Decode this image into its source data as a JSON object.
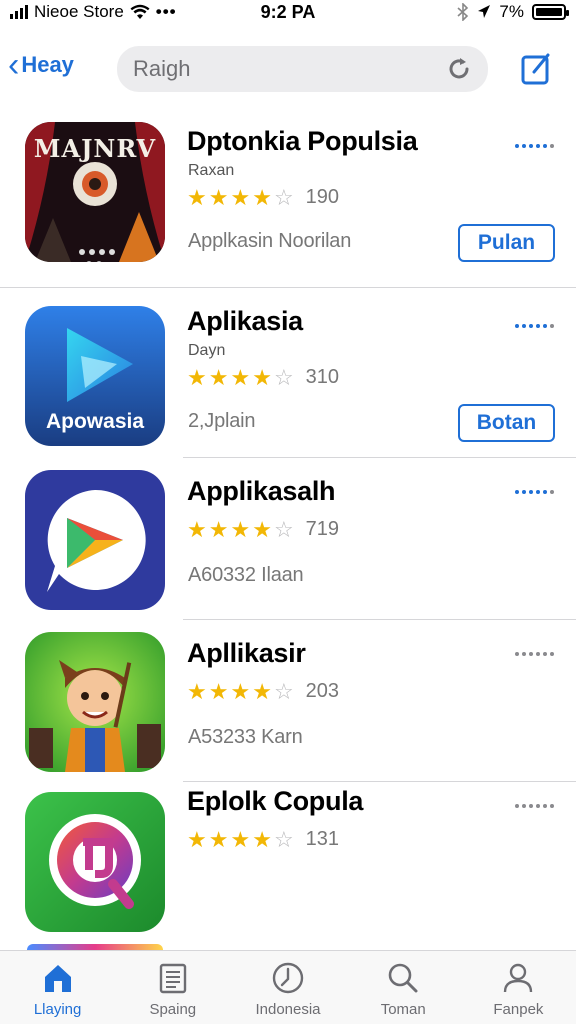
{
  "status_bar": {
    "carrier": "Nieoe Store",
    "time": "9:2 PA",
    "battery": "7%"
  },
  "nav": {
    "back_label": "Heay",
    "search_placeholder": "Raigh"
  },
  "apps": [
    {
      "name": "Dptonkia Populsia",
      "subtitle": "Raxan",
      "rating": 4.5,
      "rating_count": "190",
      "info": "Applkasin Noorilan",
      "button_label": "Pulan",
      "icon_text": "MAJNRV"
    },
    {
      "name": "Aplikasia",
      "subtitle": "Dayn",
      "rating": 4.5,
      "rating_count": "310",
      "info": "2,Jplain",
      "button_label": "Botan",
      "icon_text": "Apowasia"
    },
    {
      "name": "Applikasalh",
      "subtitle": "",
      "rating": 4.5,
      "rating_count": "719",
      "info": "A60332 Ilaan"
    },
    {
      "name": "Apllikasir",
      "subtitle": "",
      "rating": 4.5,
      "rating_count": "203",
      "info": "A53233 Karn"
    },
    {
      "name": "Eplolk Copula",
      "subtitle": "",
      "rating": 4.5,
      "rating_count": "131",
      "info": ""
    }
  ],
  "tabs": [
    {
      "label": "Llaying",
      "icon": "home-icon",
      "active": true
    },
    {
      "label": "Spaing",
      "icon": "document-icon",
      "active": false
    },
    {
      "label": "Indonesia",
      "icon": "clock-icon",
      "active": false
    },
    {
      "label": "Toman",
      "icon": "search-icon",
      "active": false
    },
    {
      "label": "Fanpek",
      "icon": "profile-icon",
      "active": false
    }
  ],
  "colors": {
    "accent": "#1f6fd6",
    "star": "#f2b705"
  }
}
